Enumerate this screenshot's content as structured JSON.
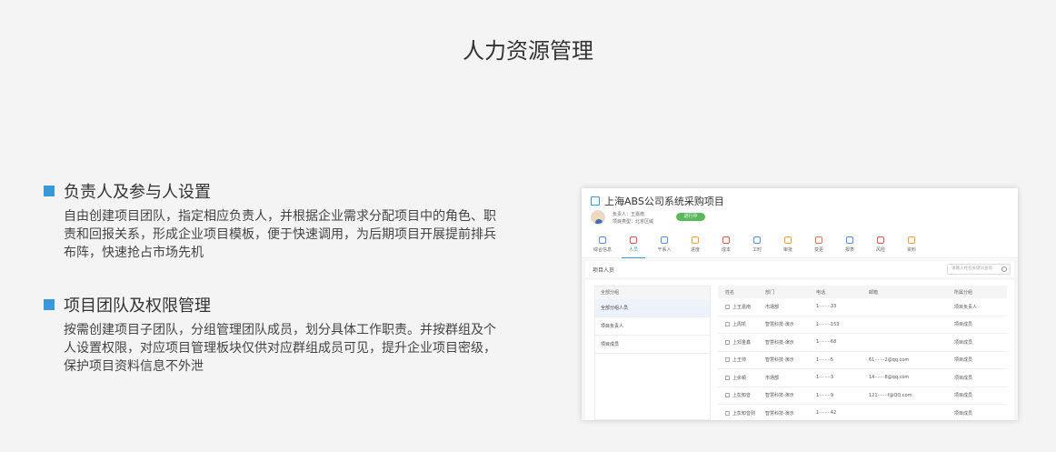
{
  "page": {
    "title": "人力资源管理"
  },
  "features": [
    {
      "title": "负责人及参与人设置",
      "lines": [
        "自由创建项目团队，指定相应负责人，并根据企业需求分配项目中的角色、职",
        "责和回报关系，形成企业项目模板，便于快速调用，为后期项目开展提前排兵",
        "布阵，快速抢占市场先机"
      ]
    },
    {
      "title": "项目团队及权限管理",
      "lines": [
        "按需创建项目子团队，分组管理团队成员，划分具体工作职责。并按群组及个",
        "人设置权限，对应项目管理板块仅供对应群组成员可见，提升企业项目密级，",
        "保护项目资料信息不外泄"
      ]
    }
  ],
  "mock": {
    "project_title": "上海ABS公司系统采购项目",
    "owner": "负责人：王嘉南",
    "project_type": "项目类型：北京区域",
    "status": "进行中",
    "tabs": [
      {
        "label": "综合信息",
        "color": "#5b8def"
      },
      {
        "label": "人员",
        "color": "#e05a4f"
      },
      {
        "label": "干系人",
        "color": "#5b8def"
      },
      {
        "label": "进度",
        "color": "#f0a040"
      },
      {
        "label": "成本",
        "color": "#e05a4f"
      },
      {
        "label": "工时",
        "color": "#5b8def"
      },
      {
        "label": "审批",
        "color": "#f0a040"
      },
      {
        "label": "变更",
        "color": "#e0774f"
      },
      {
        "label": "报表",
        "color": "#5b8def"
      },
      {
        "label": "风险",
        "color": "#e05a4f"
      },
      {
        "label": "资料",
        "color": "#f0a040"
      }
    ],
    "subbar_label": "项目人员",
    "search_placeholder": "请输入姓名关键词查询",
    "group_header": "全部分组",
    "groups": [
      "全部分组人员",
      "项目负责人",
      "项目成员"
    ],
    "table_headers": [
      "姓名",
      "部门",
      "电话",
      "邮箱",
      "所属分组"
    ],
    "rows": [
      [
        "上王嘉南",
        "市场部",
        "1········33",
        "",
        "项目负责人"
      ],
      [
        "上周凯",
        "智慧科技-演示",
        "1········153",
        "",
        "项目成员"
      ],
      [
        "上邓金鑫",
        "智慧科技-演示",
        "1········68",
        "",
        "项目成员"
      ],
      [
        "上王帅",
        "智慧科技-演示",
        "1········5",
        "61·······2@qq.com",
        "项目成员"
      ],
      [
        "上余顿",
        "市场部",
        "1········3",
        "14·······8@qq.com",
        "项目成员"
      ],
      [
        "上彭知音",
        "智慧科技-演示",
        "1········9",
        "121·······f@QQ.com",
        "项目成员"
      ],
      [
        "上彭知音则",
        "智慧科技-演示",
        "1········42",
        "",
        "项目成员"
      ]
    ]
  }
}
